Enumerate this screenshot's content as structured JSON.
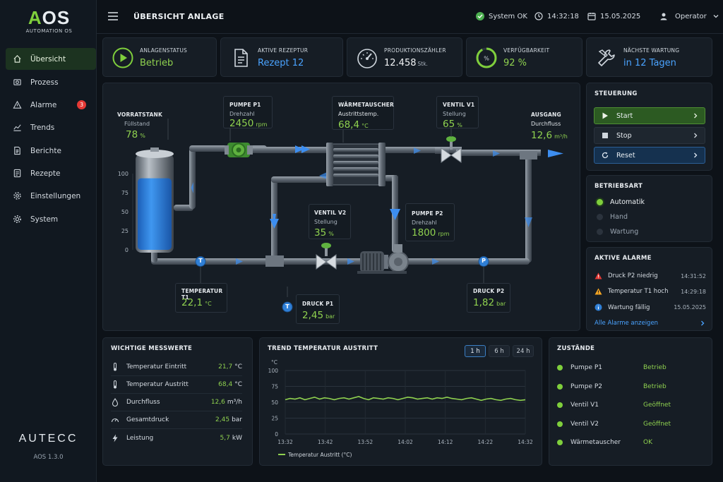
{
  "app": {
    "logo_main": "AOS",
    "logo_sub": "AUTOMATION OS",
    "brand": "AUTECC",
    "version": "AOS 1.3.0"
  },
  "sidebar": {
    "items": [
      {
        "label": "Übersicht",
        "icon": "home-icon",
        "active": true
      },
      {
        "label": "Prozess",
        "icon": "process-icon"
      },
      {
        "label": "Alarme",
        "icon": "warning-icon",
        "badge": "3"
      },
      {
        "label": "Trends",
        "icon": "trend-icon"
      },
      {
        "label": "Berichte",
        "icon": "report-icon"
      },
      {
        "label": "Rezepte",
        "icon": "recipe-icon"
      },
      {
        "label": "Einstellungen",
        "icon": "gear-icon"
      },
      {
        "label": "System",
        "icon": "system-icon"
      }
    ]
  },
  "header": {
    "title": "ÜBERSICHT ANLAGE",
    "system_status": "System OK",
    "time": "14:32:18",
    "date": "15.05.2025",
    "user": "Operator"
  },
  "kpis": {
    "status": {
      "label": "ANLAGENSTATUS",
      "value": "Betrieb"
    },
    "recipe": {
      "label": "AKTIVE REZEPTUR",
      "value": "Rezept 12"
    },
    "counter": {
      "label": "PRODUKTIONSZÄHLER",
      "value": "12.458",
      "unit": "Stk."
    },
    "availability": {
      "label": "VERFÜGBARKEIT",
      "value": "92 %",
      "fraction": 0.92
    },
    "maintenance": {
      "label": "NÄCHSTE WARTUNG",
      "value": "in 12 Tagen"
    }
  },
  "process": {
    "tank": {
      "label": "VORRATSTANK",
      "sub": "Füllstand",
      "value": "78",
      "unit": "%",
      "level": 0.78,
      "scale": [
        "100",
        "75",
        "50",
        "25",
        "0"
      ]
    },
    "pump1": {
      "label": "PUMPE P1",
      "sub": "Drehzahl",
      "value": "2450",
      "unit": "rpm"
    },
    "hx": {
      "label": "WÄRMETAUSCHER",
      "sub": "Austrittstemp.",
      "value": "68,4",
      "unit": "°C"
    },
    "valve1": {
      "label": "VENTIL V1",
      "sub": "Stellung",
      "value": "65",
      "unit": "%"
    },
    "outlet": {
      "label": "AUSGANG",
      "sub": "Durchfluss",
      "value": "12,6",
      "unit": "m³/h"
    },
    "valve2": {
      "label": "VENTIL V2",
      "sub": "Stellung",
      "value": "35",
      "unit": "%"
    },
    "pump2": {
      "label": "PUMPE P2",
      "sub": "Drehzahl",
      "value": "1800",
      "unit": "rpm"
    },
    "temp1": {
      "label": "TEMPERATUR T1",
      "value": "22,1",
      "unit": "°C",
      "marker": "T"
    },
    "press1": {
      "label": "DRUCK P1",
      "value": "2,45",
      "unit": "bar",
      "marker": "T"
    },
    "press2": {
      "label": "DRUCK P2",
      "value": "1,82",
      "unit": "bar",
      "marker": "P"
    }
  },
  "control": {
    "title": "STEUERUNG",
    "start": "Start",
    "stop": "Stop",
    "reset": "Reset"
  },
  "mode": {
    "title": "BETRIEBSART",
    "options": [
      "Automatik",
      "Hand",
      "Wartung"
    ],
    "selected": "Automatik"
  },
  "alarms": {
    "title": "AKTIVE ALARME",
    "items": [
      {
        "text": "Druck P2 niedrig",
        "time": "14:31:52",
        "level": "error"
      },
      {
        "text": "Temperatur T1 hoch",
        "time": "14:29:18",
        "level": "warning"
      },
      {
        "text": "Wartung fällig",
        "time": "15.05.2025",
        "level": "info"
      }
    ],
    "link": "Alle Alarme anzeigen"
  },
  "measurements": {
    "title": "WICHTIGE MESSWERTE",
    "rows": [
      {
        "label": "Temperatur Eintritt",
        "value": "21,7",
        "unit": "°C",
        "icon": "thermometer-icon"
      },
      {
        "label": "Temperatur Austritt",
        "value": "68,4",
        "unit": "°C",
        "icon": "thermometer-icon"
      },
      {
        "label": "Durchfluss",
        "value": "12,6",
        "unit": "m³/h",
        "icon": "drop-icon"
      },
      {
        "label": "Gesamtdruck",
        "value": "2,45",
        "unit": "bar",
        "icon": "gauge-icon"
      },
      {
        "label": "Leistung",
        "value": "5,7",
        "unit": "kW",
        "icon": "bolt-icon"
      }
    ]
  },
  "trend": {
    "title": "TREND TEMPERATUR AUSTRITT",
    "ranges": [
      "1 h",
      "6 h",
      "24 h"
    ],
    "active_range": "1 h",
    "chart_data": {
      "type": "line",
      "ylabel": "°C",
      "ylim": [
        0,
        100
      ],
      "yticks": [
        "100",
        "75",
        "50",
        "25",
        "0"
      ],
      "xticks": [
        "13:32",
        "13:42",
        "13:52",
        "14:02",
        "14:12",
        "14:22",
        "14:32"
      ],
      "series": [
        {
          "name": "Temperatur Austritt (°C)",
          "color": "#8fd14f",
          "values": [
            54,
            56,
            55,
            57,
            54,
            56,
            58,
            55,
            57,
            56,
            54,
            56,
            57,
            55,
            57,
            59,
            56,
            54,
            57,
            56,
            55,
            57,
            56,
            54,
            56,
            58,
            57,
            55,
            56,
            57,
            55,
            57,
            56,
            58,
            56,
            55,
            54,
            56,
            57,
            55,
            53,
            55,
            56,
            54,
            53,
            55,
            56,
            54,
            53,
            54
          ]
        }
      ]
    }
  },
  "states": {
    "title": "ZUSTÄNDE",
    "rows": [
      {
        "label": "Pumpe P1",
        "value": "Betrieb"
      },
      {
        "label": "Pumpe P2",
        "value": "Betrieb"
      },
      {
        "label": "Ventil V1",
        "value": "Geöffnet"
      },
      {
        "label": "Ventil V2",
        "value": "Geöffnet"
      },
      {
        "label": "Wärmetauscher",
        "value": "OK"
      }
    ]
  },
  "colors": {
    "accent": "#7fcf3c",
    "water": "#2f7fd6",
    "flow": "#3d8ef0",
    "error": "#e53935",
    "warning": "#f5a623",
    "info": "#4aa3ff"
  }
}
